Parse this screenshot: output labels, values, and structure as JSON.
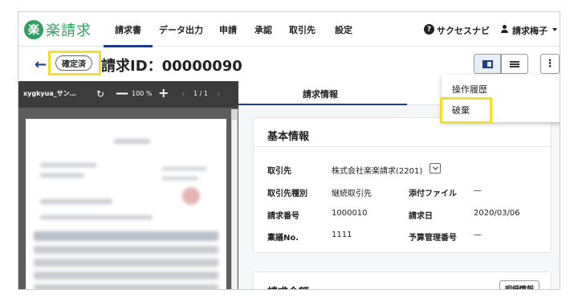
{
  "brand": {
    "logo_char": "楽",
    "name": "楽請求",
    "color": "#2f9e5f"
  },
  "nav": {
    "tabs": [
      {
        "label": "請求書",
        "active": true
      },
      {
        "label": "データ出力"
      },
      {
        "label": "申請"
      },
      {
        "label": "承認"
      },
      {
        "label": "取引先"
      },
      {
        "label": "設定"
      }
    ],
    "help_icon": "question-circle-icon",
    "help_label": "サクセスナビ",
    "user_label": "請求梅子"
  },
  "header": {
    "back_icon": "←",
    "status": "確定済",
    "title": "請求ID：00000090"
  },
  "toolbar": {
    "more_glyph": "⋮"
  },
  "menu": {
    "items": [
      "操作履歴",
      "破棄"
    ]
  },
  "viewer": {
    "filename": "xygkyua_サン…",
    "rotate_glyph": "↻",
    "zoom_minus": "—",
    "zoom": "100 %",
    "zoom_plus": "+",
    "prev_glyph": "‹",
    "page": "1 / 1",
    "next_glyph": "›"
  },
  "panel": {
    "tabs": [
      "請求情報"
    ]
  },
  "basic": {
    "title": "基本情報",
    "partner_label": "取引先",
    "partner_value": "株式会社楽楽請求(2201)",
    "type_label": "取引先種別",
    "type_value": "継続取引先",
    "attach_label": "添付ファイル",
    "attach_value": "—",
    "number_label": "請求番号",
    "number_value": "1000010",
    "date_label": "請求日",
    "date_value": "2020/03/06",
    "ringi_label": "稟議No.",
    "ringi_value": "1111",
    "budget_label": "予算管理番号",
    "budget_value": "—"
  },
  "amount": {
    "title": "請求金額",
    "detail_button": "明細情報"
  },
  "colors": {
    "accent": "#1e3a8a",
    "highlight": "#f3e02a",
    "viewer_bg": "#3c3c3c"
  }
}
